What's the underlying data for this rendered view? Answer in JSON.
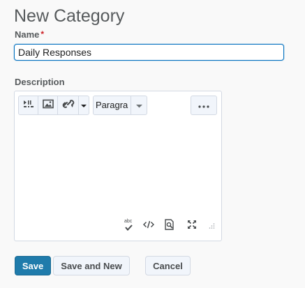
{
  "page": {
    "title": "New Category"
  },
  "name_field": {
    "label": "Name",
    "required_marker": "*",
    "value": "Daily Responses"
  },
  "description": {
    "label": "Description",
    "toolbar": {
      "format_value": "Paragra",
      "icons": [
        "insert-stuff-icon",
        "insert-image-icon",
        "insert-link-icon",
        "dropdown-caret-icon",
        "more-icon"
      ]
    },
    "footer_icons": [
      "spellcheck-icon",
      "source-code-icon",
      "preview-icon",
      "fullscreen-icon",
      "resize-grip-icon"
    ],
    "spellcheck_text": "abc"
  },
  "buttons": {
    "save": "Save",
    "save_and_new": "Save and New",
    "cancel": "Cancel"
  },
  "colors": {
    "accent": "#1f7bab",
    "focus_border": "#006fbf",
    "required": "#cd2026"
  }
}
